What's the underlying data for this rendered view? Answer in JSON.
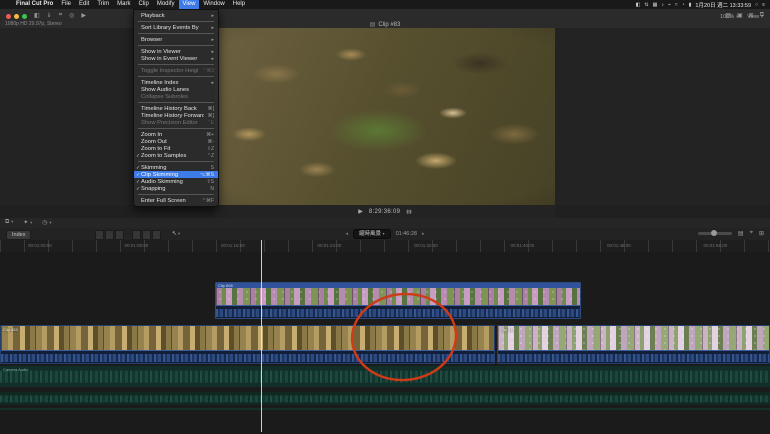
{
  "menu_bar": {
    "apple_glyph": "",
    "items": [
      "Final Cut Pro",
      "File",
      "Edit",
      "Trim",
      "Mark",
      "Clip",
      "Modify",
      "View",
      "Window",
      "Help"
    ],
    "active_item": "View",
    "status_items": [
      {
        "name": "display-icon",
        "glyph": "◧"
      },
      {
        "name": "sync-icon",
        "glyph": "⇅"
      },
      {
        "name": "keyboard-icon",
        "glyph": "▦"
      },
      {
        "name": "volume-icon",
        "glyph": "♪"
      },
      {
        "name": "airplay-icon",
        "glyph": "⌁"
      },
      {
        "name": "wifi-icon",
        "glyph": "≈"
      },
      {
        "name": "time-machine-icon",
        "glyph": "◔"
      },
      {
        "name": "battery-icon",
        "glyph": "▮"
      }
    ],
    "clock": "1月20日 週二 13:33:59",
    "spotlight_glyph": "○",
    "notification_glyph": "≡"
  },
  "view_menu": {
    "sections": [
      {
        "items": [
          {
            "label": "Playback",
            "submenu": true
          }
        ]
      },
      {
        "items": [
          {
            "label": "Sort Library Events By",
            "submenu": true
          }
        ]
      },
      {
        "items": [
          {
            "label": "Browser",
            "submenu": true
          }
        ]
      },
      {
        "items": [
          {
            "label": "Show in Viewer",
            "submenu": true
          },
          {
            "label": "Show in Event Viewer",
            "submenu": true
          }
        ]
      },
      {
        "items": [
          {
            "label": "Toggle Inspector Height",
            "shortcut": "⌃⌘3",
            "disabled": true
          }
        ]
      },
      {
        "items": [
          {
            "label": "Timeline Index",
            "submenu": true
          },
          {
            "label": "Show Audio Lanes"
          },
          {
            "label": "Collapse Subroles",
            "disabled": true
          }
        ]
      },
      {
        "items": [
          {
            "label": "Timeline History Back",
            "shortcut": "⌘["
          },
          {
            "label": "Timeline History Forward",
            "shortcut": "⌘]"
          },
          {
            "label": "Show Precision Editor",
            "shortcut": "⌃E",
            "disabled": true
          }
        ]
      },
      {
        "items": [
          {
            "label": "Zoom In",
            "shortcut": "⌘+"
          },
          {
            "label": "Zoom Out",
            "shortcut": "⌘-"
          },
          {
            "label": "Zoom to Fit",
            "shortcut": "⇧Z"
          },
          {
            "label": "Zoom to Samples",
            "shortcut": "⌃Z",
            "checked": true
          }
        ]
      },
      {
        "items": [
          {
            "label": "Skimming",
            "shortcut": "S",
            "checked": true
          },
          {
            "label": "Clip Skimming",
            "shortcut": "⌥⌘S",
            "checked": true,
            "highlighted": true
          },
          {
            "label": "Audio Skimming",
            "shortcut": "⇧S",
            "checked": true
          },
          {
            "label": "Snapping",
            "shortcut": "N",
            "checked": true
          }
        ]
      },
      {
        "items": [
          {
            "label": "Enter Full Screen",
            "shortcut": "⌃⌘F"
          }
        ]
      }
    ]
  },
  "window": {
    "browser_info": "1080p HD 29.97p, Stereo",
    "viewer": {
      "title": "Clip #83",
      "title_icon": "▤",
      "zoom_level": "100%",
      "view_label": "View"
    },
    "transport": {
      "play_glyph": "▶",
      "timecode": "8:29:36:09"
    }
  },
  "timeline": {
    "index_button": "Index",
    "project": {
      "name": "縮時風景",
      "duration": "01:46:28"
    },
    "ruler_labels": [
      "00:01:00:00",
      "00:01:08:00",
      "00:01:16:00",
      "00:01:24:00",
      "00:01:32:00",
      "00:01:40:00",
      "00:01:48:00",
      "00:01:56:00"
    ],
    "clips": {
      "connected": {
        "name": "Clip 608"
      },
      "primary_left": {
        "name": "Clip 453"
      },
      "primary_right": {
        "name": "Clip 512"
      },
      "audio_lane": {
        "name": "Camera Audio"
      }
    },
    "annotation_color": "#cf3a17"
  }
}
